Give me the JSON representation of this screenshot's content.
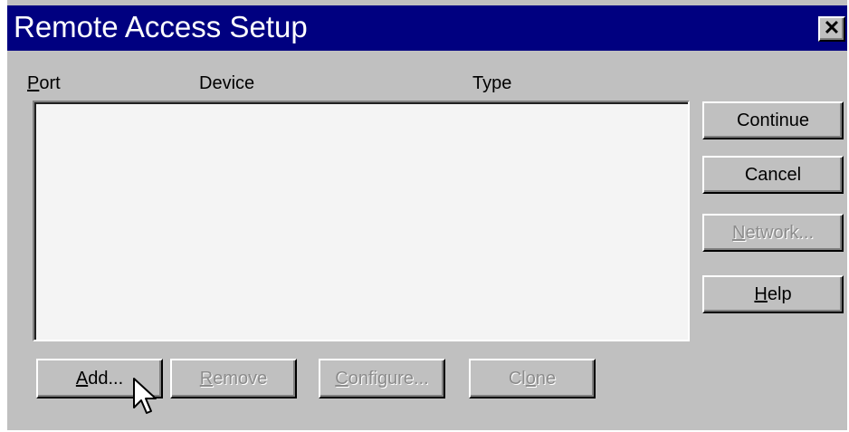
{
  "window": {
    "title": "Remote Access Setup",
    "close_icon": "close-x-icon",
    "titlebar_color": "#000080",
    "face_color": "#c0c0c0"
  },
  "list": {
    "columns": [
      "Port",
      "Device",
      "Type"
    ],
    "rows": []
  },
  "side_buttons": {
    "continue": "Continue",
    "cancel": "Cancel",
    "network": "Network...",
    "help": "Help"
  },
  "bottom_buttons": {
    "add": "Add...",
    "remove": "Remove",
    "configure": "Configure...",
    "clone": "Clone"
  },
  "states": {
    "network_enabled": false,
    "remove_enabled": false,
    "configure_enabled": false,
    "clone_enabled": false
  },
  "cursor": "arrow-pointer-icon"
}
